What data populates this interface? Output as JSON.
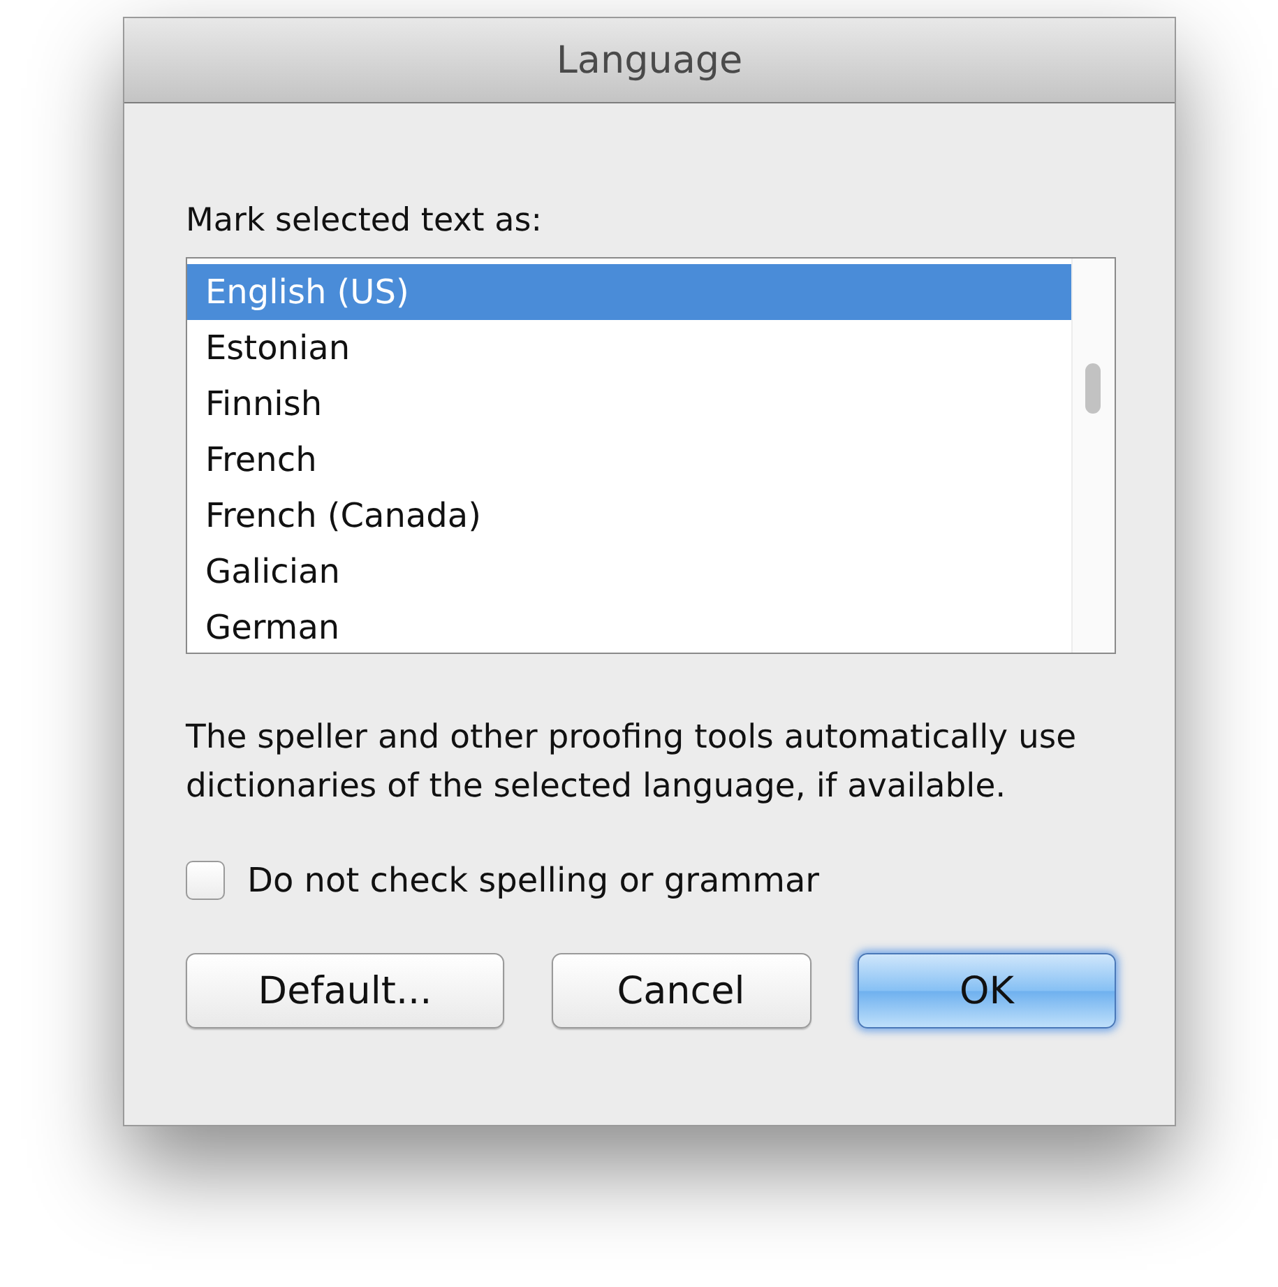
{
  "window": {
    "title": "Language"
  },
  "list_label": "Mark selected text as:",
  "languages": [
    {
      "label": "English (US)",
      "selected": true
    },
    {
      "label": "Estonian",
      "selected": false
    },
    {
      "label": "Finnish",
      "selected": false
    },
    {
      "label": "French",
      "selected": false
    },
    {
      "label": "French (Canada)",
      "selected": false
    },
    {
      "label": "Galician",
      "selected": false
    },
    {
      "label": "German",
      "selected": false
    }
  ],
  "description": "The speller and other proofing tools automatically use dictionaries of the selected language, if available.",
  "no_check": {
    "label": "Do not check spelling or grammar",
    "checked": false
  },
  "buttons": [
    {
      "label": "Default...",
      "default": false
    },
    {
      "label": "Cancel",
      "default": false
    },
    {
      "label": "OK",
      "default": true
    }
  ]
}
